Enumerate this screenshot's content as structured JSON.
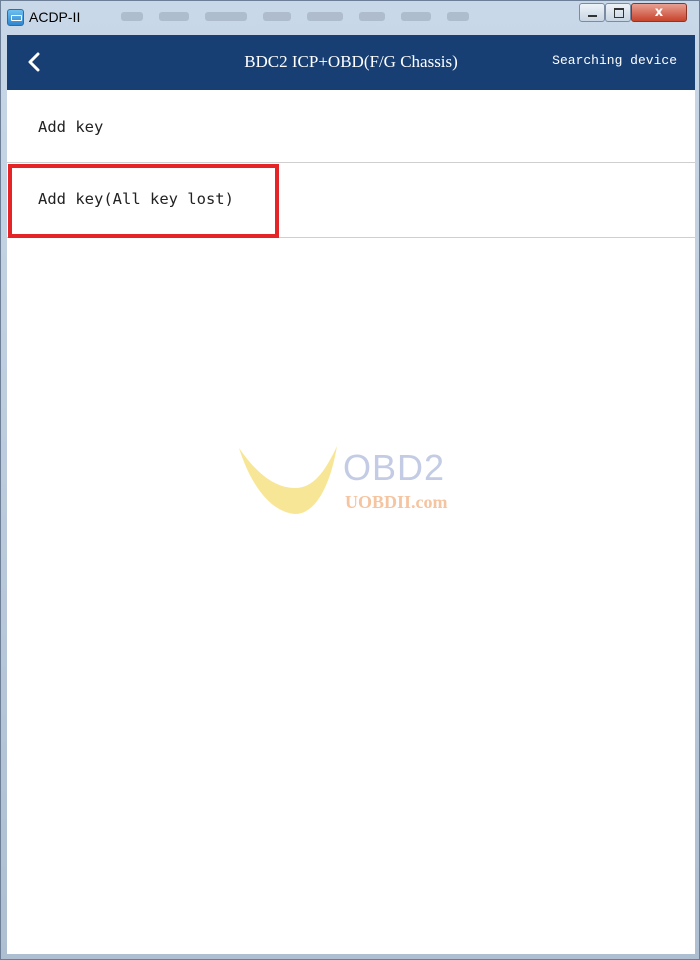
{
  "window": {
    "title": "ACDP-II",
    "icons": {
      "app": "acdp-app-icon",
      "minimize": "minimize-icon",
      "maximize": "maximize-icon",
      "close": "close-icon"
    },
    "close_glyph": "x"
  },
  "header": {
    "back_icon": "chevron-left-icon",
    "title": "BDC2 ICP+OBD(F/G Chassis)",
    "status": "Searching device",
    "background_color": "#183f74"
  },
  "menu": {
    "items": [
      {
        "label": "Add key"
      },
      {
        "label": "Add key(All key lost)",
        "highlighted": true
      }
    ],
    "highlight_color": "#e42427"
  },
  "watermark": {
    "logo": "obd2-logo",
    "brand": "OBD2",
    "site": "UOBDII.com"
  }
}
